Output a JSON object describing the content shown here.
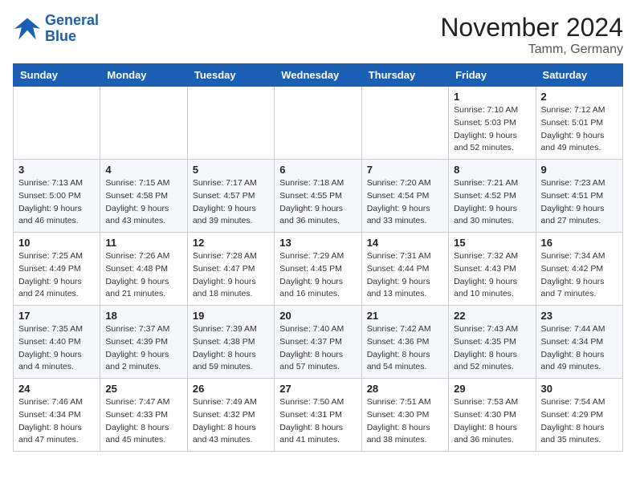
{
  "header": {
    "logo_line1": "General",
    "logo_line2": "Blue",
    "month_title": "November 2024",
    "location": "Tamm, Germany"
  },
  "weekdays": [
    "Sunday",
    "Monday",
    "Tuesday",
    "Wednesday",
    "Thursday",
    "Friday",
    "Saturday"
  ],
  "weeks": [
    [
      {
        "day": "",
        "info": ""
      },
      {
        "day": "",
        "info": ""
      },
      {
        "day": "",
        "info": ""
      },
      {
        "day": "",
        "info": ""
      },
      {
        "day": "",
        "info": ""
      },
      {
        "day": "1",
        "info": "Sunrise: 7:10 AM\nSunset: 5:03 PM\nDaylight: 9 hours\nand 52 minutes."
      },
      {
        "day": "2",
        "info": "Sunrise: 7:12 AM\nSunset: 5:01 PM\nDaylight: 9 hours\nand 49 minutes."
      }
    ],
    [
      {
        "day": "3",
        "info": "Sunrise: 7:13 AM\nSunset: 5:00 PM\nDaylight: 9 hours\nand 46 minutes."
      },
      {
        "day": "4",
        "info": "Sunrise: 7:15 AM\nSunset: 4:58 PM\nDaylight: 9 hours\nand 43 minutes."
      },
      {
        "day": "5",
        "info": "Sunrise: 7:17 AM\nSunset: 4:57 PM\nDaylight: 9 hours\nand 39 minutes."
      },
      {
        "day": "6",
        "info": "Sunrise: 7:18 AM\nSunset: 4:55 PM\nDaylight: 9 hours\nand 36 minutes."
      },
      {
        "day": "7",
        "info": "Sunrise: 7:20 AM\nSunset: 4:54 PM\nDaylight: 9 hours\nand 33 minutes."
      },
      {
        "day": "8",
        "info": "Sunrise: 7:21 AM\nSunset: 4:52 PM\nDaylight: 9 hours\nand 30 minutes."
      },
      {
        "day": "9",
        "info": "Sunrise: 7:23 AM\nSunset: 4:51 PM\nDaylight: 9 hours\nand 27 minutes."
      }
    ],
    [
      {
        "day": "10",
        "info": "Sunrise: 7:25 AM\nSunset: 4:49 PM\nDaylight: 9 hours\nand 24 minutes."
      },
      {
        "day": "11",
        "info": "Sunrise: 7:26 AM\nSunset: 4:48 PM\nDaylight: 9 hours\nand 21 minutes."
      },
      {
        "day": "12",
        "info": "Sunrise: 7:28 AM\nSunset: 4:47 PM\nDaylight: 9 hours\nand 18 minutes."
      },
      {
        "day": "13",
        "info": "Sunrise: 7:29 AM\nSunset: 4:45 PM\nDaylight: 9 hours\nand 16 minutes."
      },
      {
        "day": "14",
        "info": "Sunrise: 7:31 AM\nSunset: 4:44 PM\nDaylight: 9 hours\nand 13 minutes."
      },
      {
        "day": "15",
        "info": "Sunrise: 7:32 AM\nSunset: 4:43 PM\nDaylight: 9 hours\nand 10 minutes."
      },
      {
        "day": "16",
        "info": "Sunrise: 7:34 AM\nSunset: 4:42 PM\nDaylight: 9 hours\nand 7 minutes."
      }
    ],
    [
      {
        "day": "17",
        "info": "Sunrise: 7:35 AM\nSunset: 4:40 PM\nDaylight: 9 hours\nand 4 minutes."
      },
      {
        "day": "18",
        "info": "Sunrise: 7:37 AM\nSunset: 4:39 PM\nDaylight: 9 hours\nand 2 minutes."
      },
      {
        "day": "19",
        "info": "Sunrise: 7:39 AM\nSunset: 4:38 PM\nDaylight: 8 hours\nand 59 minutes."
      },
      {
        "day": "20",
        "info": "Sunrise: 7:40 AM\nSunset: 4:37 PM\nDaylight: 8 hours\nand 57 minutes."
      },
      {
        "day": "21",
        "info": "Sunrise: 7:42 AM\nSunset: 4:36 PM\nDaylight: 8 hours\nand 54 minutes."
      },
      {
        "day": "22",
        "info": "Sunrise: 7:43 AM\nSunset: 4:35 PM\nDaylight: 8 hours\nand 52 minutes."
      },
      {
        "day": "23",
        "info": "Sunrise: 7:44 AM\nSunset: 4:34 PM\nDaylight: 8 hours\nand 49 minutes."
      }
    ],
    [
      {
        "day": "24",
        "info": "Sunrise: 7:46 AM\nSunset: 4:34 PM\nDaylight: 8 hours\nand 47 minutes."
      },
      {
        "day": "25",
        "info": "Sunrise: 7:47 AM\nSunset: 4:33 PM\nDaylight: 8 hours\nand 45 minutes."
      },
      {
        "day": "26",
        "info": "Sunrise: 7:49 AM\nSunset: 4:32 PM\nDaylight: 8 hours\nand 43 minutes."
      },
      {
        "day": "27",
        "info": "Sunrise: 7:50 AM\nSunset: 4:31 PM\nDaylight: 8 hours\nand 41 minutes."
      },
      {
        "day": "28",
        "info": "Sunrise: 7:51 AM\nSunset: 4:30 PM\nDaylight: 8 hours\nand 38 minutes."
      },
      {
        "day": "29",
        "info": "Sunrise: 7:53 AM\nSunset: 4:30 PM\nDaylight: 8 hours\nand 36 minutes."
      },
      {
        "day": "30",
        "info": "Sunrise: 7:54 AM\nSunset: 4:29 PM\nDaylight: 8 hours\nand 35 minutes."
      }
    ]
  ]
}
